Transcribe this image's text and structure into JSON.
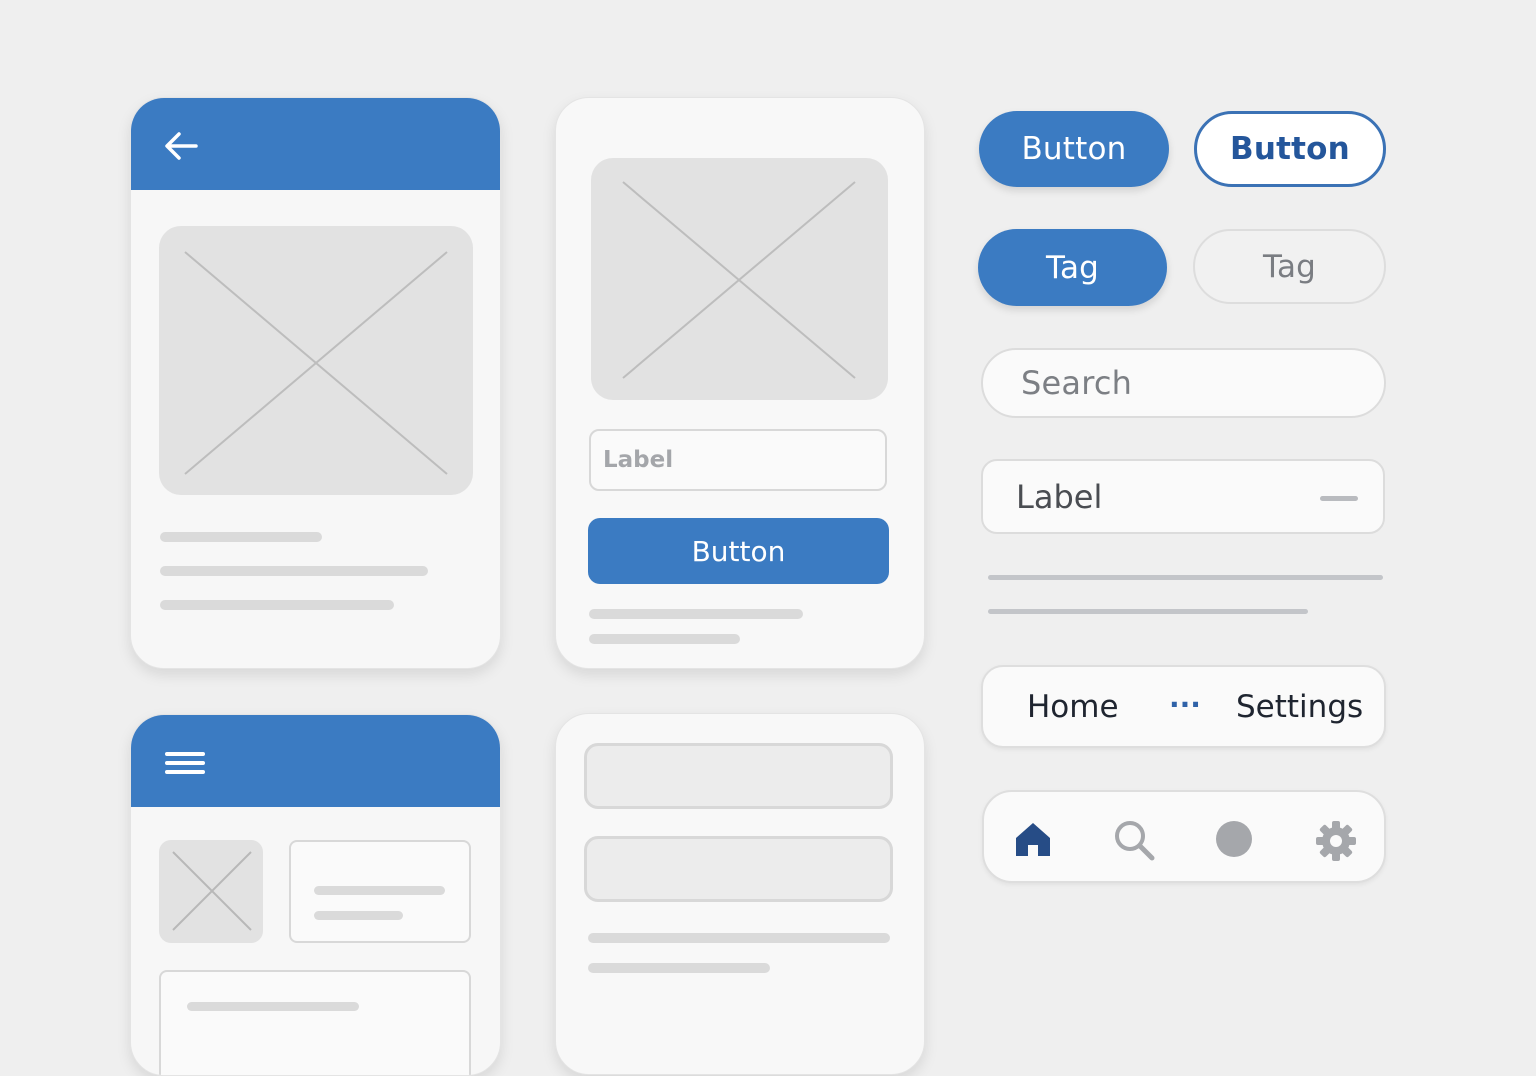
{
  "colors": {
    "primary": "#3b7bc2",
    "primary_dark": "#24569b",
    "background": "#efefef"
  },
  "cards": {
    "detail": {
      "back_icon": "arrow-left-icon",
      "image_icon": "image-placeholder-icon"
    },
    "form": {
      "field_label": "Label",
      "button_label": "Button",
      "image_icon": "image-placeholder-icon"
    },
    "list": {
      "menu_icon": "hamburger-menu-icon",
      "thumb_icon": "image-placeholder-icon"
    }
  },
  "components": {
    "button_solid": "Button",
    "button_outline": "Button",
    "tag_active": "Tag",
    "tag_inactive": "Tag",
    "search_placeholder": "Search",
    "select_label": "Label",
    "nav": {
      "home": "Home",
      "more": "···",
      "settings": "Settings"
    },
    "tabbar": [
      "home-icon",
      "search-icon",
      "circle-icon",
      "gear-icon"
    ]
  }
}
